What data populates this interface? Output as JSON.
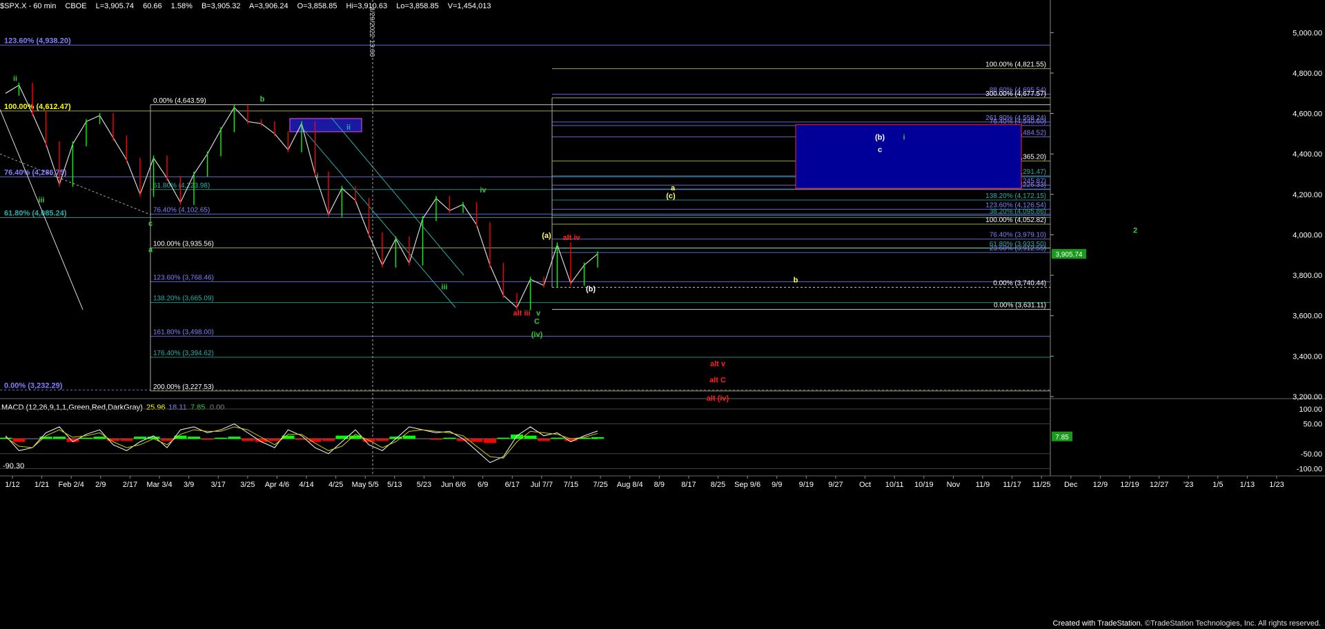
{
  "header": {
    "symbol": "$SPX.X - 60 min",
    "exchange": "CBOE",
    "last": "L=3,905.74",
    "change": "60.66",
    "change_pct": "1.58%",
    "bid": "B=3,905.32",
    "ask": "A=3,906.24",
    "open": "O=3,858.85",
    "high": "Hi=3,910.63",
    "low": "Lo=3,858.85",
    "volume": "V=1,454,013"
  },
  "footer": {
    "created": "Created with TradeStation.",
    "copyright": "©TradeStation Technologies, Inc. All rights reserved."
  },
  "colors": {
    "background": "#000000",
    "up": "#00ff00",
    "down": "#ff0000",
    "blue_line": "#8080ff",
    "teal": "#20b2aa",
    "yellow": "#ffff00",
    "wave_green": "#33cc33",
    "wave_red": "#ff2020",
    "box_blue": "#000099",
    "box_border": "#ff2222"
  },
  "chart_data": [
    {
      "type": "line",
      "title": "",
      "ylim": [
        3200,
        5100
      ],
      "price_ticks": [
        "5,000.00",
        "4,800.00",
        "4,600.00",
        "4,400.00",
        "4,200.00",
        "4,000.00",
        "3,800.00",
        "3,600.00",
        "3,400.00",
        "3,200.00"
      ],
      "price_tick_values": [
        5000,
        4800,
        4600,
        4400,
        4200,
        4000,
        3800,
        3600,
        3400,
        3200
      ],
      "last_price_label": "3,905.74",
      "last_price": 3905.74,
      "x_ticks": [
        "1/12",
        "1/21",
        "Feb 2/4",
        "2/9",
        "2/17",
        "Mar 3/4",
        "3/9",
        "3/17",
        "3/25",
        "Apr 4/6",
        "4/14",
        "4/25",
        "May 5/5",
        "5/13",
        "5/23",
        "Jun 6/6",
        "6/9",
        "6/17",
        "Jul 7/7",
        "7/15",
        "7/25",
        "Aug 8/4",
        "8/9",
        "8/17",
        "8/25",
        "Sep 9/6",
        "9/9",
        "9/19",
        "9/27",
        "Oct",
        "10/11",
        "10/19",
        "Nov",
        "11/9",
        "11/17",
        "11/25",
        "Dec",
        "12/9",
        "12/19",
        "12/27",
        "'23",
        "1/5",
        "1/13",
        "1/23"
      ],
      "vertical_marker_label": "4/29/2022 13:00",
      "series": [
        {
          "values": [
            4700,
            4740,
            4600,
            4450,
            4250,
            4450,
            4560,
            4590,
            4480,
            4370,
            4200,
            4380,
            4280,
            4160,
            4300,
            4400,
            4520,
            4630,
            4560,
            4550,
            4500,
            4420,
            4550,
            4300,
            4100,
            4230,
            4170,
            4000,
            3850,
            3980,
            3860,
            4080,
            4180,
            4120,
            4150,
            4050,
            3850,
            3700,
            3640,
            3780,
            3750,
            3950,
            3760,
            3850,
            3905.74
          ]
        }
      ],
      "fib_levels": [
        {
          "label": "123.60% (4,938.20)",
          "value": 4938.2
        },
        {
          "label": "100.00% (4,612.47)",
          "value": 4612.47
        },
        {
          "label": "76.40% (4,286.75)",
          "value": 4286.75
        },
        {
          "label": "61.80% (4,085.24)",
          "value": 4085.24
        },
        {
          "label": "0.00% (4,643.59)",
          "value": 4643.59
        },
        {
          "label": "61.80% (4,223.98)",
          "value": 4223.98
        },
        {
          "label": "76.40% (4,102.65)",
          "value": 4102.65
        },
        {
          "label": "100.00% (3,935.56)",
          "value": 3935.56
        },
        {
          "label": "123.60% (3,768.46)",
          "value": 3768.46
        },
        {
          "label": "138.20% (3,665.09)",
          "value": 3665.09
        },
        {
          "label": "161.80% (3,498.00)",
          "value": 3498
        },
        {
          "label": "176.40% (3,394.62)",
          "value": 3394.62
        },
        {
          "label": "200.00% (3,227.53)",
          "value": 3227.53
        },
        {
          "label": "0.00% (3,232.29)",
          "value": 3232.29
        },
        {
          "label": "100.00% (4,821.55)",
          "value": 4821.55
        },
        {
          "label": "88.60% (4,695.54)",
          "value": 4695.54
        },
        {
          "label": "300.00% (4,677.57)",
          "value": 4677.57
        },
        {
          "label": "261.80% (4,558.24)",
          "value": 4558.24
        },
        {
          "label": "76.40% (4,540.60)",
          "value": 4540.6
        },
        {
          "label": "238.20% (4,484.52)",
          "value": 4484.52
        },
        {
          "label": "200.00% (4,365.20)",
          "value": 4365.2
        },
        {
          "label": "176.40% (4,291.47)",
          "value": 4291.47
        },
        {
          "label": "161.80% (4,245.87)",
          "value": 4245.87
        },
        {
          "label": "50.00% (4,226.33)",
          "value": 4226.33
        },
        {
          "label": "138.20% (4,172.15)",
          "value": 4172.15
        },
        {
          "label": "123.60% (4,126.54)",
          "value": 4126.54
        },
        {
          "label": "38.20% (4,095.86)",
          "value": 4095.86
        },
        {
          "label": "100.00% (4,052.82)",
          "value": 4052.82
        },
        {
          "label": "76.40% (3,979.10)",
          "value": 3979.1
        },
        {
          "label": "61.80% (3,933.50)",
          "value": 3933.5
        },
        {
          "label": "23.60% (3,912.55)",
          "value": 3912.55
        },
        {
          "label": "0.00% (3,740.44)",
          "value": 3740.44
        },
        {
          "label": "0.00% (3,631.11)",
          "value": 3631.11
        }
      ],
      "wave_labels": [
        {
          "text": "ii",
          "value": 4760,
          "color": "green"
        },
        {
          "text": "b",
          "value": 4660,
          "color": "green"
        },
        {
          "text": "iii",
          "value": 4160,
          "color": "green"
        },
        {
          "text": "c",
          "value": 4045,
          "color": "green"
        },
        {
          "text": "a",
          "value": 3915,
          "color": "green"
        },
        {
          "text": "i",
          "value": 4280,
          "color": "green"
        },
        {
          "text": "ii",
          "value": 4520,
          "color": "teal"
        },
        {
          "text": "iii",
          "value": 3730,
          "color": "green"
        },
        {
          "text": "iv",
          "value": 4210,
          "color": "green"
        },
        {
          "text": "alt iii",
          "value": 3600,
          "color": "red"
        },
        {
          "text": "v",
          "value": 3600,
          "color": "green"
        },
        {
          "text": "C",
          "value": 3560,
          "color": "green"
        },
        {
          "text": "(iv)",
          "value": 3495,
          "color": "green"
        },
        {
          "text": "(a)",
          "value": 3985,
          "color": "yellow"
        },
        {
          "text": "alt iv",
          "value": 3975,
          "color": "red"
        },
        {
          "text": "(b)",
          "value": 3720,
          "color": "white"
        },
        {
          "text": "a",
          "value": 4220,
          "color": "yellow"
        },
        {
          "text": "(c)",
          "value": 4180,
          "color": "yellow"
        },
        {
          "text": "b",
          "value": 3765,
          "color": "yellow"
        },
        {
          "text": "(b)",
          "value": 4470,
          "color": "white"
        },
        {
          "text": "i",
          "value": 4470,
          "color": "green"
        },
        {
          "text": "c",
          "value": 4410,
          "color": "white"
        },
        {
          "text": "2",
          "value": 4010,
          "color": "green"
        },
        {
          "text": "alt v",
          "value": 3350,
          "color": "red"
        },
        {
          "text": "alt C",
          "value": 3270,
          "color": "red"
        },
        {
          "text": "alt (iv)",
          "value": 3180,
          "color": "red"
        }
      ]
    },
    {
      "type": "line",
      "title": "",
      "legend_label": "MACD (12,26,9,1,1,Green,Red,DarkGray)",
      "readouts": [
        "25.96",
        "18.11",
        "7.85",
        "0.00"
      ],
      "ticks": [
        "100.00",
        "50.00",
        "-50.00",
        "-100.00"
      ],
      "tick_values": [
        100,
        50,
        -50,
        -100
      ],
      "last_value_label": "7.85",
      "last_value": 7.85,
      "min_label": "-90.30",
      "min_value": -90.3,
      "ylim": [
        -120,
        130
      ],
      "series": [
        {
          "name": "MACD",
          "values": [
            10,
            -40,
            -30,
            20,
            40,
            -10,
            15,
            30,
            -20,
            -40,
            -10,
            10,
            -30,
            30,
            40,
            20,
            30,
            50,
            20,
            -10,
            -30,
            30,
            10,
            -30,
            -50,
            -10,
            30,
            -20,
            -40,
            0,
            40,
            30,
            20,
            25,
            0,
            -40,
            -80,
            -60,
            10,
            40,
            10,
            20,
            -10,
            10,
            25.96
          ]
        },
        {
          "name": "Signal",
          "values": [
            5,
            -25,
            -30,
            10,
            30,
            5,
            10,
            20,
            -10,
            -30,
            -20,
            0,
            -20,
            15,
            30,
            25,
            25,
            40,
            30,
            5,
            -20,
            15,
            15,
            -15,
            -40,
            -25,
            15,
            -5,
            -30,
            -10,
            25,
            30,
            25,
            20,
            10,
            -25,
            -60,
            -65,
            -10,
            25,
            20,
            15,
            0,
            5,
            18.11
          ]
        }
      ]
    }
  ]
}
